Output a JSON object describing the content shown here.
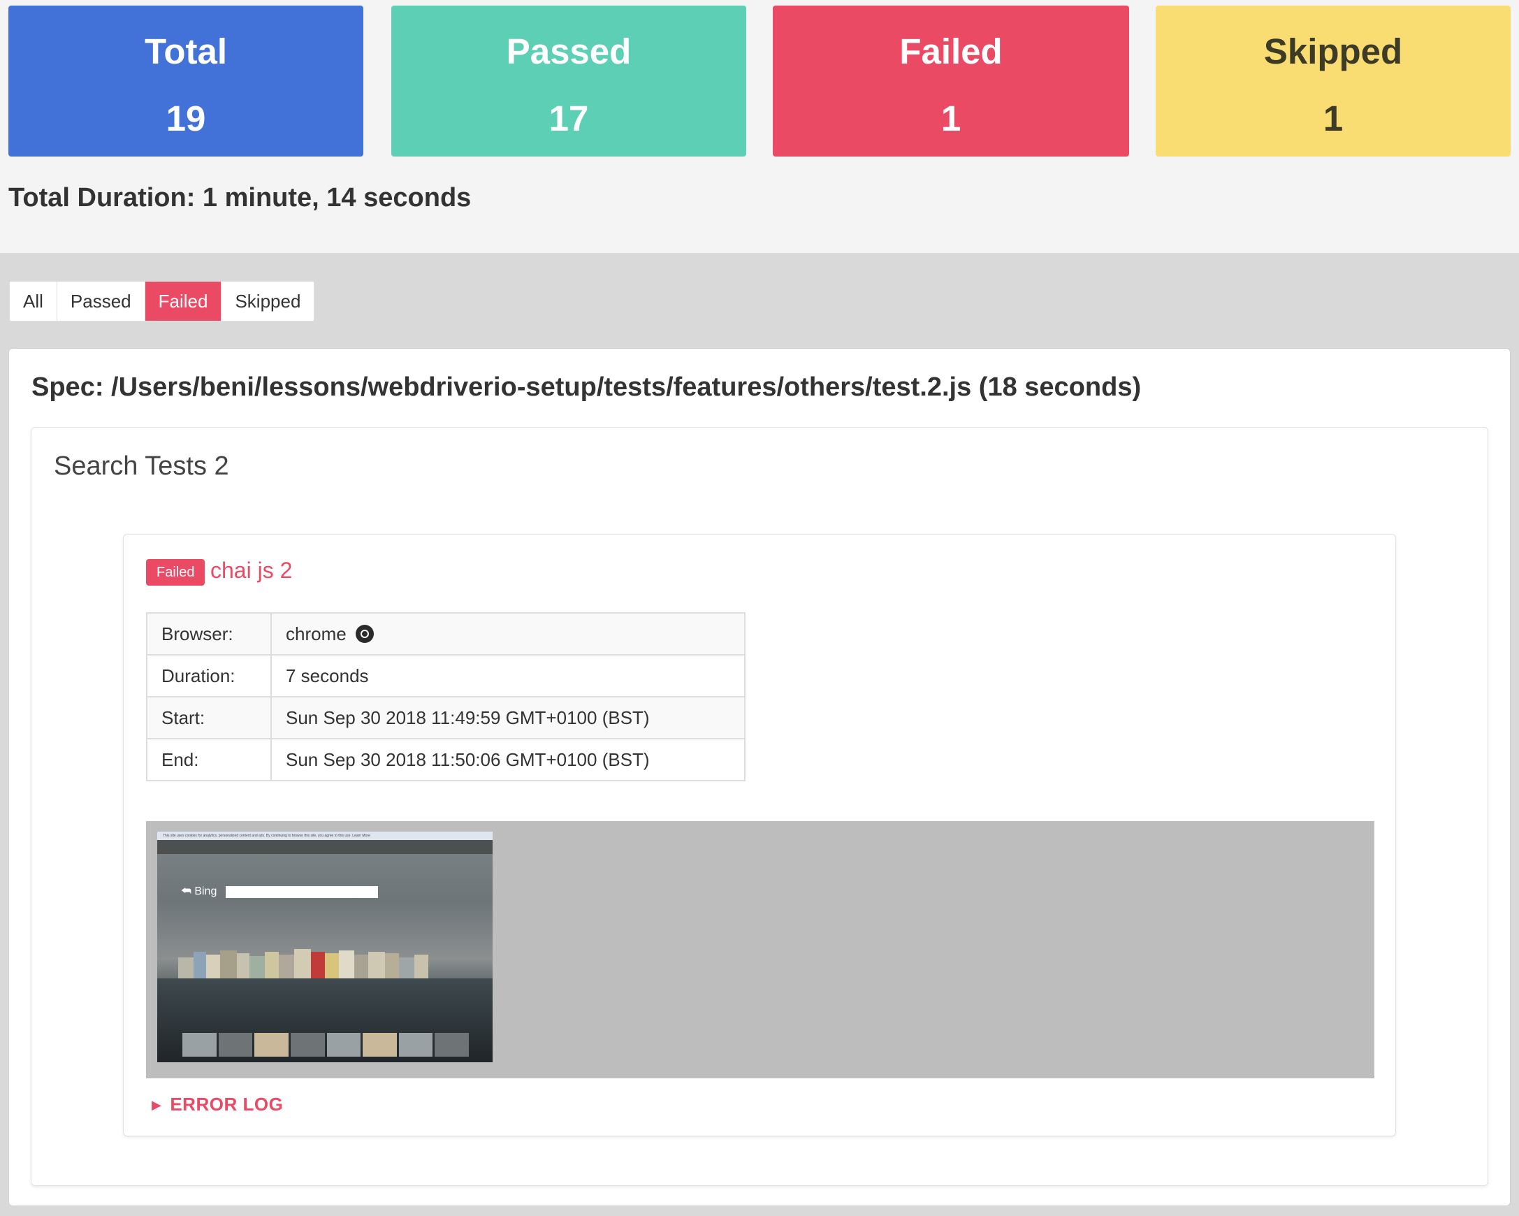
{
  "summary": {
    "total": {
      "label": "Total",
      "value": "19"
    },
    "passed": {
      "label": "Passed",
      "value": "17"
    },
    "failed": {
      "label": "Failed",
      "value": "1"
    },
    "skipped": {
      "label": "Skipped",
      "value": "1"
    },
    "duration": "Total Duration: 1 minute, 14 seconds"
  },
  "filters": {
    "all": "All",
    "passed": "Passed",
    "failed": "Failed",
    "skipped": "Skipped",
    "active": "Failed"
  },
  "spec": {
    "title": "Spec: /Users/beni/lessons/webdriverio-setup/tests/features/others/test.2.js (18 seconds)",
    "suite": {
      "title": "Search Tests 2",
      "test": {
        "status": "Failed",
        "name": "chai js 2",
        "details": [
          {
            "label": "Browser:",
            "value": "chrome",
            "icon": "chrome-icon"
          },
          {
            "label": "Duration:",
            "value": "7 seconds"
          },
          {
            "label": "Start:",
            "value": "Sun Sep 30 2018 11:49:59 GMT+0100 (BST)"
          },
          {
            "label": "End:",
            "value": "Sun Sep 30 2018 11:50:06 GMT+0100 (BST)"
          }
        ],
        "screenshot": {
          "logo_text": "Bing",
          "cookie_notice": "This site uses cookies for analytics, personalized content and ads. By continuing to browse this site, you agree to this use. Learn More"
        },
        "error_log_label": "ERROR LOG"
      }
    }
  },
  "colors": {
    "total": "#4272d7",
    "passed": "#5dcfb4",
    "failed": "#eb4a65",
    "skipped": "#fadd72"
  }
}
